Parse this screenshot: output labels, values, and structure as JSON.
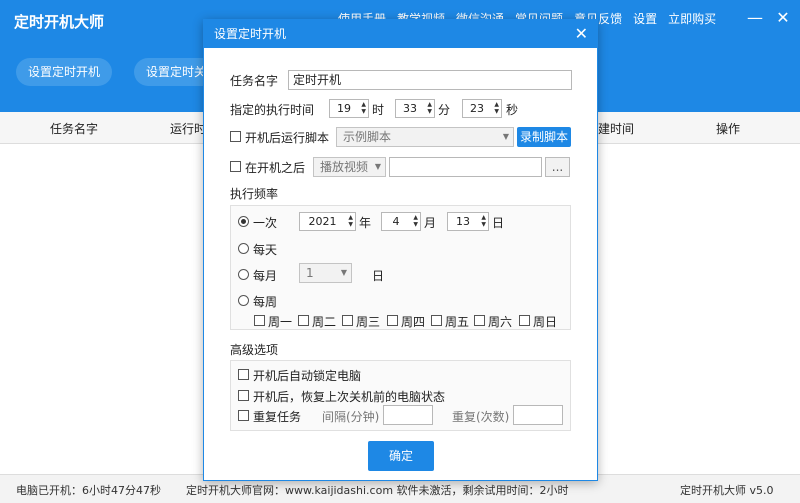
{
  "app": {
    "title": "定时开机大师",
    "nav": [
      "使用手册",
      "教学视频",
      "微信沟通",
      "常见问题",
      "意见反馈",
      "设置",
      "立即购买"
    ],
    "win_minimize": "—",
    "win_close": "✕"
  },
  "toolbar": {
    "set_boot_label": "设置定时开机",
    "set_shutdown_label": "设置定时关"
  },
  "table": {
    "headers": [
      "任务名字",
      "运行时",
      "建时间",
      "操作"
    ]
  },
  "status": {
    "uptime": "电脑已开机：6小时47分47秒",
    "website": "定时开机大师官网：www.kaijidashi.com 软件未激活，剩余试用时间：2小时",
    "version": "定时开机大师 v5.0"
  },
  "dialog": {
    "title": "设置定时开机",
    "close": "✕",
    "task_name_label": "任务名字",
    "task_name_value": "定时开机",
    "exec_time_label": "指定的执行时间",
    "hour": "19",
    "hour_unit": "时",
    "minute": "33",
    "minute_unit": "分",
    "second": "23",
    "second_unit": "秒",
    "run_script_label": "开机后运行脚本",
    "script_select": "示例脚本",
    "record_script_btn": "录制脚本",
    "after_boot_label": "在开机之后",
    "after_boot_select": "播放视频",
    "after_boot_path": "",
    "browse_btn": "...",
    "frequency_title": "执行频率",
    "freq_once": "一次",
    "year": "2021",
    "year_unit": "年",
    "month": "4",
    "month_unit": "月",
    "day": "13",
    "day_unit": "日",
    "freq_daily": "每天",
    "freq_monthly": "每月",
    "monthly_day": "1",
    "monthly_day_unit": "日",
    "freq_weekly": "每周",
    "weekdays": [
      "周一",
      "周二",
      "周三",
      "周四",
      "周五",
      "周六",
      "周日"
    ],
    "advanced_title": "高级选项",
    "auto_lock_label": "开机后自动锁定电脑",
    "restore_state_label": "开机后，恢复上次关机前的电脑状态",
    "repeat_task_label": "重复任务",
    "interval_label": "间隔(分钟)",
    "interval_value": "",
    "repeat_count_label": "重复(次数)",
    "repeat_count_value": "",
    "confirm_btn": "确定"
  }
}
